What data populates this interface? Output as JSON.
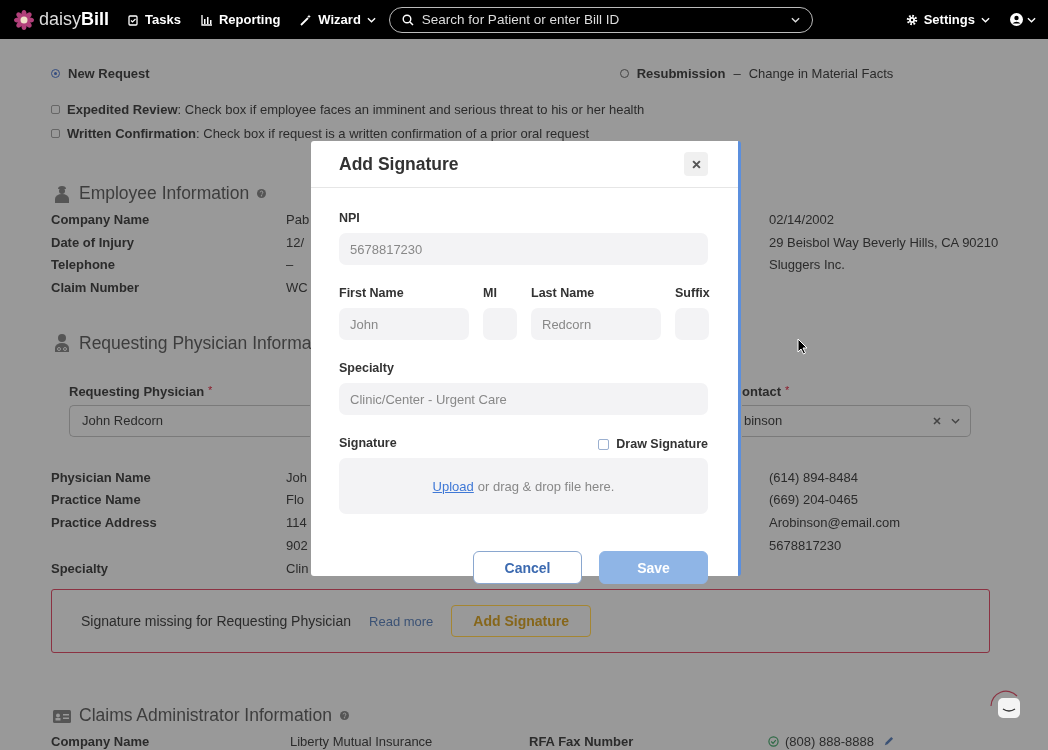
{
  "nav": {
    "logo": "daisy**Bill**",
    "items": [
      {
        "label": "Tasks"
      },
      {
        "label": "Reporting"
      },
      {
        "label": "Wizard",
        "dropdown": true
      }
    ],
    "search": {
      "placeholder": "Search for Patient or enter Bill ID"
    },
    "settings": "Settings"
  },
  "request_types": [
    {
      "label": "New Request",
      "selected": true
    },
    {
      "label": "Resubmission",
      "separator": "–",
      "note": "Change in Material Facts",
      "selected": false
    }
  ],
  "options": [
    {
      "text": "**Expedited Review**: Check box if employee faces an imminent and serious threat to his or her health",
      "checked": false
    },
    {
      "text": "**Written Confirmation**: Check box if request is a written confirmation of a prior oral request",
      "checked": false
    }
  ],
  "employee": {
    "title": "Employee Information",
    "rows": [
      {
        "label": "Company Name",
        "value": [
          "Pab"
        ]
      },
      {
        "label": "Date of Injury",
        "value": [
          "12/"
        ]
      },
      {
        "label": "Telephone",
        "value": [
          "–"
        ]
      },
      {
        "label": "Claim Number",
        "value": [
          "WC"
        ]
      }
    ],
    "right_values": [
      "02/14/2002",
      "29 Beisbol Way Beverly Hills, CA 90210",
      "Sluggers Inc."
    ]
  },
  "physician": {
    "title": "Requesting Physician Informa",
    "field": {
      "label": "Requesting Physician",
      "required_mark": "*",
      "value": "John Redcorn"
    },
    "contact_field": {
      "label": "ontact",
      "required_mark": "*",
      "value": "binson"
    },
    "rows": [
      {
        "label": "Physician Name",
        "value": [
          "Joh"
        ]
      },
      {
        "label": "Practice Name",
        "value": [
          "Flo"
        ]
      },
      {
        "label": "Practice Address",
        "value": [
          "114",
          "902"
        ]
      },
      {
        "label": "Specialty",
        "value": [
          "Clin"
        ]
      }
    ],
    "right_values": [
      "(614) 894-8484",
      "(669) 204-0465",
      "Arobinson@email.com",
      "5678817230"
    ]
  },
  "alert": {
    "message": "Signature missing for Requesting Physician",
    "link": "Read more",
    "button": "Add Signature"
  },
  "claims": {
    "title": "Claims Administrator Information",
    "rows": [
      {
        "label": "Company Name",
        "value": "Liberty Mutual Insurance",
        "label_2": "RFA Fax Number",
        "value_2": "(808) 888-8888",
        "verified": true
      }
    ]
  },
  "modal": {
    "title": "Add Signature",
    "npi": {
      "label": "NPI",
      "value": "5678817230"
    },
    "name_fields": [
      {
        "label": "First Name",
        "value": "John"
      },
      {
        "label": "MI"
      },
      {
        "label": "Last Name",
        "value": "Redcorn"
      },
      {
        "label": "Suffix"
      }
    ],
    "specialty": {
      "label": "Specialty",
      "value": "Clinic/Center - Urgent Care"
    },
    "signature": {
      "label": "Signature",
      "draw_label": "Draw Signature",
      "draw_checked": false,
      "upload_link": "Upload",
      "upload_text": "or drag & drop file here."
    },
    "buttons": [
      {
        "label": "Cancel",
        "kind": "secondary",
        "disabled": false
      },
      {
        "label": "Save",
        "kind": "primary",
        "disabled": true
      }
    ]
  }
}
